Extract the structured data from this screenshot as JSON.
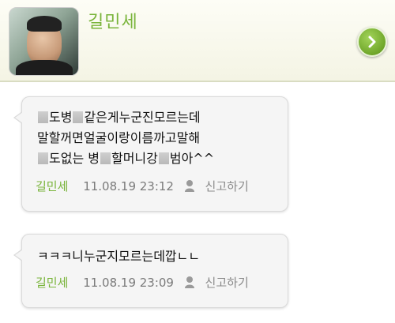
{
  "profile": {
    "name": "길민세"
  },
  "comments": [
    {
      "lines": [
        {
          "segments": [
            "",
            "도병",
            "같은게누군진모르는데"
          ]
        },
        {
          "segments": [
            "말할꺼면얼굴이랑이름까고말해"
          ]
        },
        {
          "segments": [
            "",
            "도없는 병",
            "할머니강",
            "범아^^"
          ]
        }
      ],
      "author": "길민세",
      "date": "11.08.19 23:12",
      "report_label": "신고하기"
    },
    {
      "lines": [
        {
          "segments": [
            "ㅋㅋㅋ니누군지모르는데깝ㄴㄴ"
          ]
        }
      ],
      "author": "길민세",
      "date": "11.08.19 23:09",
      "report_label": "신고하기"
    }
  ],
  "icons": {
    "next": "chevron-right-icon",
    "report": "person-silhouette-icon"
  },
  "colors": {
    "accent_green": "#79b43a",
    "header_bg": "#f4f4e4",
    "bubble_bg": "#f5f5f5"
  }
}
